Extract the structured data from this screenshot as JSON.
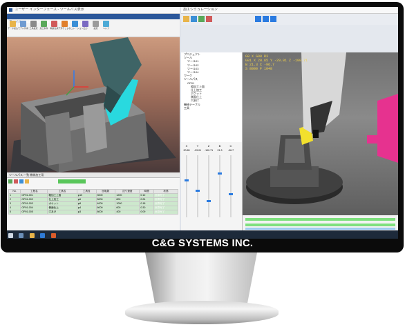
{
  "brand": "C&G SYSTEMS INC.",
  "left_app": {
    "title_glyphs": "ユーザー インターフェース - ツールパス表示",
    "ribbon_tabs": [
      "ファイル",
      "編集",
      "表示",
      "加工",
      "解析",
      "測定",
      "ツール"
    ],
    "ribbon_buttons": [
      "データ読込",
      "モデル作成",
      "工具設定",
      "加工条件",
      "軌跡生成",
      "干渉チェック",
      "シミュレーション",
      "出力",
      "設定",
      "ヘルプ"
    ],
    "status_text": "ツールパス.一覧 機械加工用",
    "table": {
      "headers": [
        "No.",
        "工程名",
        "工具名",
        "工具径",
        "回転数",
        "送り速度",
        "時間",
        "状態"
      ],
      "rows": [
        [
          "1",
          "OP01-001",
          "粗加工上面",
          "φ10",
          "3000",
          "1200",
          "0:12",
          "計算完了"
        ],
        [
          "2",
          "OP01-002",
          "仕上加工",
          "φ6",
          "5000",
          "800",
          "0:24",
          "計算完了"
        ],
        [
          "3",
          "OP01-003",
          "ポケット",
          "φ8",
          "4000",
          "1000",
          "0:18",
          "計算完了"
        ],
        [
          "4",
          "OP01-004",
          "側面仕上",
          "φ4",
          "6000",
          "600",
          "0:30",
          "計算完了"
        ],
        [
          "5",
          "OP01-005",
          "穴あけ",
          "φ3",
          "8000",
          "400",
          "0:09",
          "計算完了"
        ]
      ]
    }
  },
  "right_app": {
    "title_glyphs": "加工シミュレーション",
    "readout": [
      "G0 X   G90 R3",
      "G01 X 20.65 Y -29.01 Z -100.71",
      "B 21.3 C -96.7",
      "S 8000 F 1048"
    ],
    "tree_items": [
      "プロジェクト",
      "ツール",
      "ツール01",
      "ツール02",
      "ツール03",
      "ツール04",
      "ワーク",
      "ツールパス",
      "OP01",
      "粗加工上面",
      "仕上加工",
      "ポケット",
      "側面仕上",
      "穴あけ",
      "機械テーブル",
      "工具"
    ],
    "axis_headers": [
      "X",
      "Y",
      "Z",
      "B",
      "C"
    ],
    "axis_values": [
      "20.65",
      "-29.01",
      "-100.71",
      "21.3",
      "-96.7"
    ]
  }
}
